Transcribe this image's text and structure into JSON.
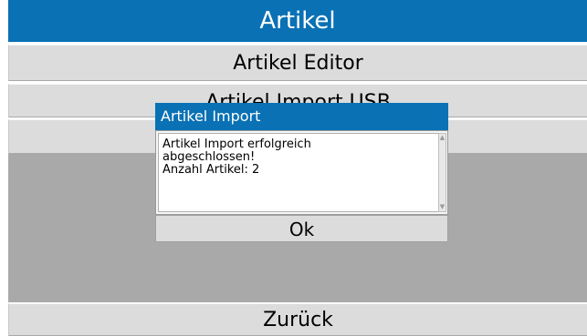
{
  "header": {
    "title": "Artikel"
  },
  "menu": {
    "editor_label": "Artikel Editor",
    "import_label": "Artikel Import USB",
    "third_label": ""
  },
  "footer": {
    "back_label": "Zurück"
  },
  "dialog": {
    "title": "Artikel Import",
    "message_lines": [
      "Artikel Import erfolgreich",
      "abgeschlossen!",
      "Anzahl Artikel: 2"
    ],
    "ok_label": "Ok",
    "scroll_up_icon": "triangle-up",
    "scroll_down_icon": "triangle-down"
  },
  "colors": {
    "accent": "#0a71b5",
    "button_bg": "#dcdcdc",
    "backdrop": "#a9a9a9"
  }
}
